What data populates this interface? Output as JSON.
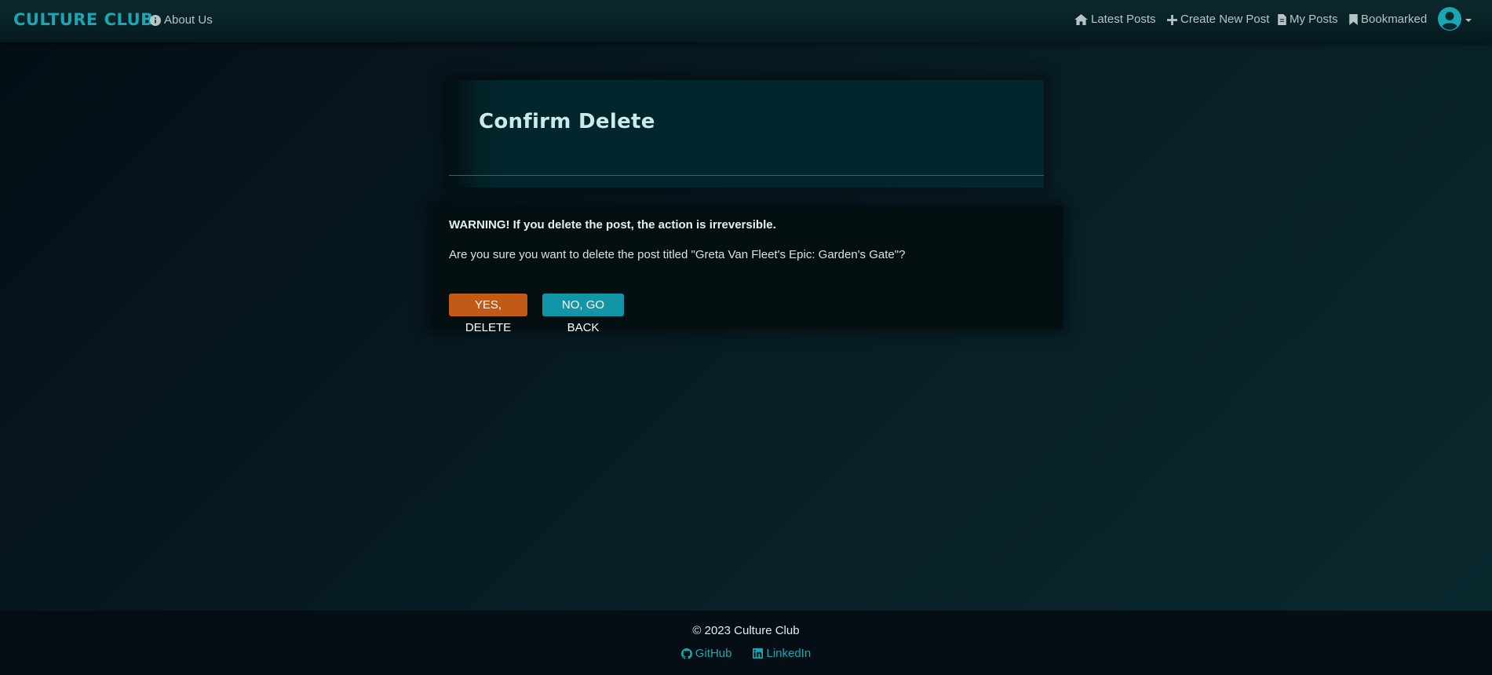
{
  "nav": {
    "brand": "CULTURE CLUB",
    "about": "About Us",
    "latest_posts": "Latest Posts",
    "create_post": "Create New Post",
    "my_posts": "My Posts",
    "bookmarked": "Bookmarked",
    "icons": {
      "about": "info-circle-icon",
      "latest_posts": "home-icon",
      "create_post": "plus-icon",
      "my_posts": "file-icon",
      "bookmarked": "bookmark-icon",
      "user": "user-circle-icon",
      "user_caret": "caret-down-icon"
    }
  },
  "page": {
    "title": "Confirm Delete"
  },
  "confirm": {
    "warning": "WARNING! If you delete the post, the action is irreversible.",
    "question": "Are you sure you want to delete the post titled \"Greta Van Fleet's Epic: Garden's Gate\"?",
    "yes_label": "YES, DELETE",
    "no_label": "NO, GO BACK"
  },
  "footer": {
    "copyright": "© 2023 Culture Club",
    "github": "GitHub",
    "linkedin": "LinkedIn",
    "icons": {
      "github": "github-icon",
      "linkedin": "linkedin-icon"
    }
  },
  "colors": {
    "accent": "#1aa6b3",
    "delete_button": "#c15a16",
    "back_button": "#1395a8",
    "navbar": "#0b2a2e",
    "footer": "#040e14"
  }
}
